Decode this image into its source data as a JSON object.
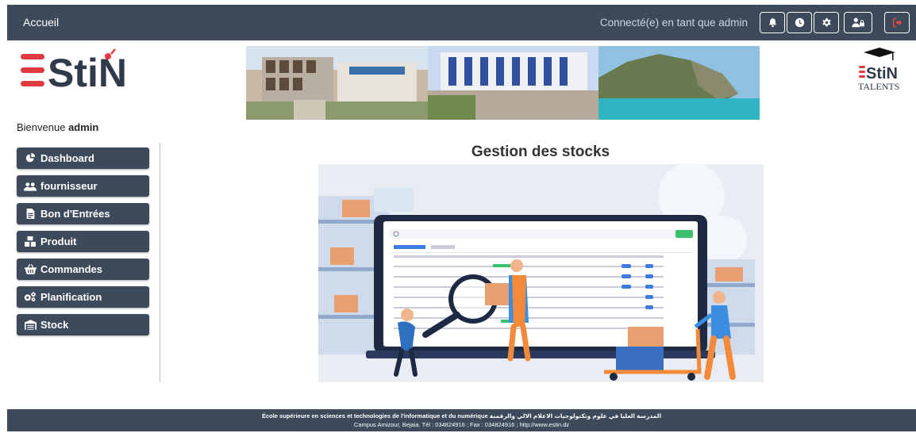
{
  "topbar": {
    "home_label": "Accueil",
    "connected_text": "Connecté(e) en tant que admin",
    "buttons": [
      "bell-icon",
      "clock-icon",
      "gear-icon",
      "user-lock-icon",
      "sign-out-icon"
    ]
  },
  "welcome": {
    "prefix": "Bienvenue",
    "username": "admin"
  },
  "sidebar": {
    "items": [
      {
        "label": "Dashboard",
        "icon": "chart-pie-icon"
      },
      {
        "label": "fournisseur",
        "icon": "users-icon"
      },
      {
        "label": "Bon d'Entrées",
        "icon": "file-invoice-icon"
      },
      {
        "label": "Produit",
        "icon": "boxes-icon"
      },
      {
        "label": "Commandes",
        "icon": "basket-icon"
      },
      {
        "label": "Planification",
        "icon": "cogs-icon"
      },
      {
        "label": "Stock",
        "icon": "warehouse-icon"
      }
    ]
  },
  "main": {
    "title": "Gestion des stocks"
  },
  "footer": {
    "line1": "École supérieure en sciences et technologies de l'informatique et du numérique المدرسة العليا في علوم وتكنولوجيات الاعلام الالي والرقمنة",
    "line2": "Campus Amizour, Bejaia. Tél : 034824916 ; Fax : 034824916 ; http://www.estin.dz"
  },
  "colors": {
    "navbar": "#3d4a5c",
    "logout": "#e74c3c",
    "accent_red": "#e03a3e",
    "logo_dark": "#2f3a4a"
  }
}
